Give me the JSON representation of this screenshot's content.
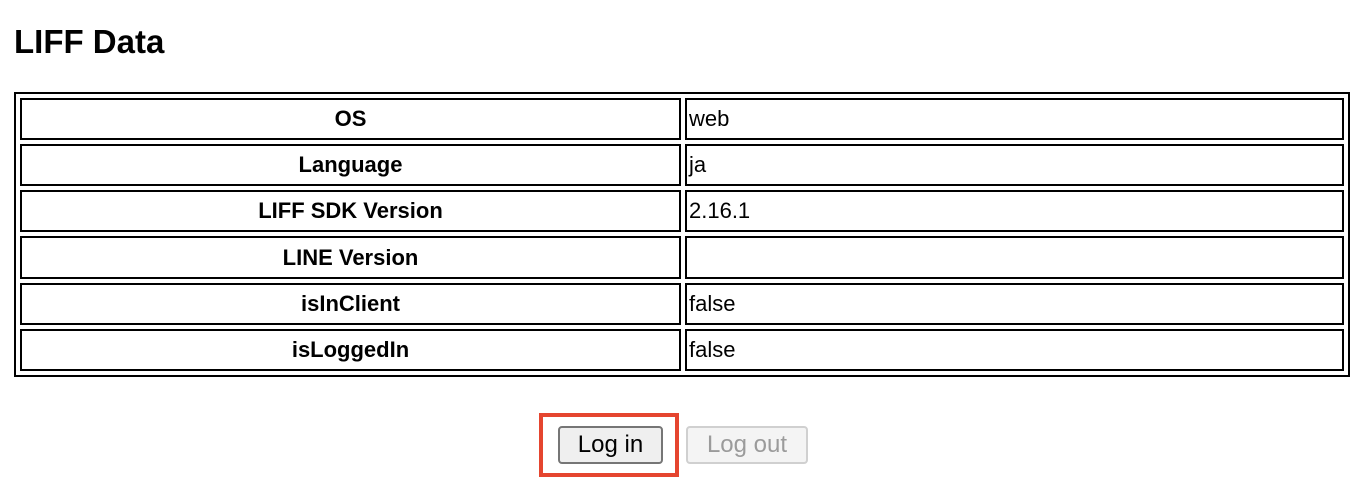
{
  "page": {
    "title": "LIFF Data"
  },
  "liff_table": {
    "rows": [
      {
        "key": "OS",
        "value": "web"
      },
      {
        "key": "Language",
        "value": "ja"
      },
      {
        "key": "LIFF SDK Version",
        "value": "2.16.1"
      },
      {
        "key": "LINE Version",
        "value": ""
      },
      {
        "key": "isInClient",
        "value": "false"
      },
      {
        "key": "isLoggedIn",
        "value": "false"
      }
    ]
  },
  "buttons": {
    "login_label": "Log in",
    "logout_label": "Log out",
    "logout_disabled": true
  },
  "colors": {
    "highlight": "#e5452f",
    "disabled_text": "#9b9b9b"
  }
}
